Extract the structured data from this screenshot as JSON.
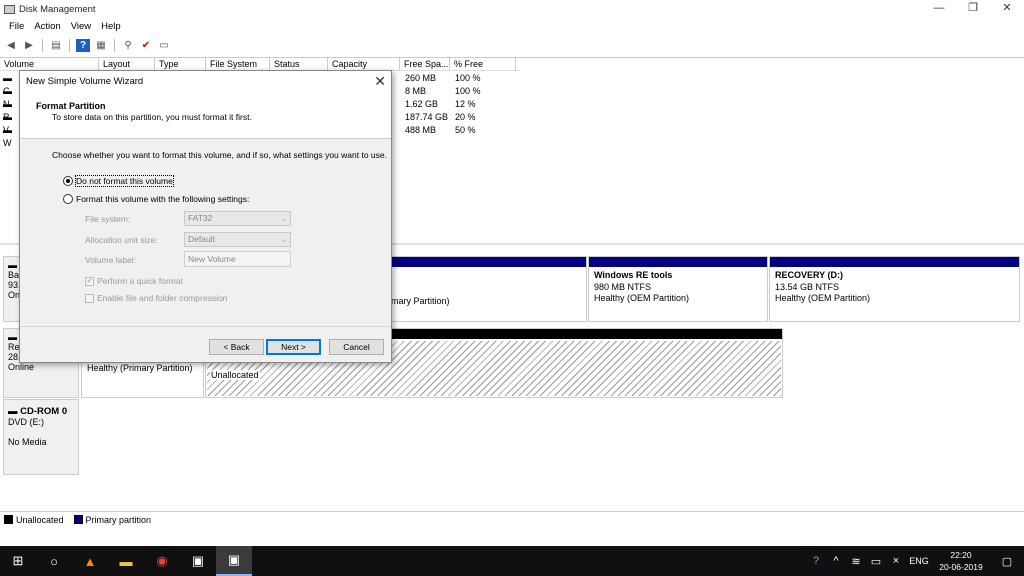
{
  "window": {
    "title": "Disk Management",
    "controls": [
      "—",
      "❐",
      "✕"
    ]
  },
  "menu": [
    "File",
    "Action",
    "View",
    "Help"
  ],
  "table": {
    "headers": [
      "Volume",
      "Layout",
      "Type",
      "File System",
      "Status",
      "Capacity",
      "Free Spa...",
      "% Free"
    ],
    "rows": [
      {
        "v": "C",
        "free": "260 MB",
        "pct": "100 %"
      },
      {
        "v": "N",
        "free": "8 MB",
        "pct": "100 %"
      },
      {
        "v": "R",
        "free": "1.62 GB",
        "pct": "12 %"
      },
      {
        "v": "V",
        "free": "187.74 GB",
        "pct": "20 %"
      },
      {
        "v": "W",
        "free": "488 MB",
        "pct": "50 %"
      }
    ]
  },
  "disks": {
    "disk0": {
      "l1": "Ba",
      "l2": "931",
      "l3": "Onl"
    },
    "disk0_parts": {
      "main_status": "rimary Partition)",
      "winre_name": "Windows RE tools",
      "winre_size": "980 MB NTFS",
      "winre_status": "Healthy (OEM Partition)",
      "recovery_name": "RECOVERY  (D:)",
      "recovery_size": "13.54 GB NTFS",
      "recovery_status": "Healthy (OEM Partition)"
    },
    "disk1": {
      "l1": "Re",
      "l2": "28.",
      "l3": "Online"
    },
    "disk1_parts": {
      "primary_status": "Healthy (Primary Partition)",
      "unalloc": "Unallocated"
    },
    "cdrom": {
      "name": "CD-ROM 0",
      "type": "DVD (E:)",
      "media": "No Media"
    }
  },
  "legend": {
    "unallocated": "Unallocated",
    "primary": "Primary partition"
  },
  "colors": {
    "primary": "#000080",
    "unallocated": "#000000",
    "accent": "#0078d7"
  },
  "dialog": {
    "title": "New Simple Volume Wizard",
    "heading": "Format Partition",
    "subheading": "To store data on this partition, you must format it first.",
    "instruction": "Choose whether you want to format this volume, and if so, what settings you want to use.",
    "opt_no_format": "Do not format this volume",
    "opt_format": "Format this volume with the following settings:",
    "file_system_label": "File system:",
    "file_system_value": "FAT32",
    "alloc_label": "Allocation unit size:",
    "alloc_value": "Default",
    "volume_label_label": "Volume label:",
    "volume_label_value": "New Volume",
    "quick_format": "Perform a quick format",
    "compression": "Enable file and folder compression",
    "back": "< Back",
    "next": "Next >",
    "cancel": "Cancel"
  },
  "tray": {
    "lang": "ENG",
    "time": "22:20",
    "date": "20-06-2019"
  }
}
